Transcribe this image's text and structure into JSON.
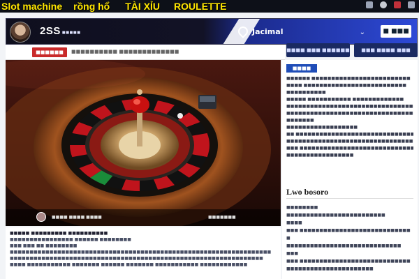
{
  "topbar": {
    "categories": [
      "Slot machine",
      "rồng hổ",
      "TÀI XỈU",
      "ROULETTE"
    ],
    "icons": [
      "menu-icon",
      "search-icon",
      "user-icon",
      "notify-icon"
    ]
  },
  "header": {
    "brand": "2SS",
    "brand_sub": "■■■■■",
    "logo_text": "Jacimal",
    "button_label": "■ ■■■"
  },
  "subbar": {
    "badge": "■■■■■■",
    "text": "■■■■■■■■■■ ■■■■■■■■■■■■■"
  },
  "right_buttons": [
    "■■■■ ■■■ ■■■■■■",
    "■■■ ■■■■ ■■■"
  ],
  "hero": {
    "footer_left": "■■■■ ■■■■ ■■■■",
    "footer_right": "■■■■■■■"
  },
  "article": {
    "lines": [
      "■■■■■ ■■■■■■■■■ ■■■■■■■■■■",
      "■■■■■■■■■■■■■■■■ ■■■■■■ ■■■■■■■■",
      "■■■ ■■■ ■■ ■■■■■■■■",
      "■■■■■■■■■■■■■■■■■■■■■■■■■■■■■■■■■■■■■■■■■■■■■■■■■■■■■■■■■■■■■■■■■■",
      "■■■■■■■■■■■■■■■■■■■■■■■■■■■■■■■■■■■■■■■■■■■■■■■■■■■■■■■■■■■■■■■■",
      "■■■■ ■■■■■■■■■■■ ■■■■■■■ ■■■■■■ ■■■■■■■ ■■■■■■■■■■■ ■■■■■■■■■■■■"
    ]
  },
  "sidebar": {
    "tag": "■■■■ ■■■",
    "lines": [
      "■■■■■■ ■■■■■■■■■■■■■■■■■■■■■■■■■",
      "■■■■ ■■■■■■■■■■■■■■■■■■■■■■■■■■",
      "■■■■■■■■■■",
      "",
      "■■■■■ ■■■■■■■■■■■ ■■■■■■■■■■■■■",
      "■■■■■■■■■■■■■■■■■■■■■■■■■■■■■■■■■",
      "■■■■■■■■■■■■■■■■■■■■■■■■■■■■■■■■■",
      "■■■■■■■",
      "■■■■■■■■■■■■■■■■■■",
      "",
      "■■ ■■■■■■■■■■■■■■■■■■■■■■■■■■■■■■",
      "■■■■■■■■■■■■■■■■■■■■■■■■■■■■■■■■■",
      "■■■ ■■■■■■■■■■■■■■■■■■■■■■■■■■■■■",
      "■■■■■■■■■■■■■■■■■"
    ],
    "section_title": "Lwo bosoro",
    "list": [
      "■■■■■■■■",
      "■■■■■■■■■■■■■■■■■■■■■■■■■",
      "■■■■",
      "■■■ ■■■■■■■■■■■■■■■■■■■■■■■■■■■■",
      "■",
      "■■■■■■■■■■■■■■■■■■■■■■■■■■■■■",
      "■■■",
      "■■■ ■■■■■■■■■■■■■■■■■■■■■■■■■■■■",
      "■■■■■■■■■■■■■■■■■■■■■■"
    ]
  }
}
